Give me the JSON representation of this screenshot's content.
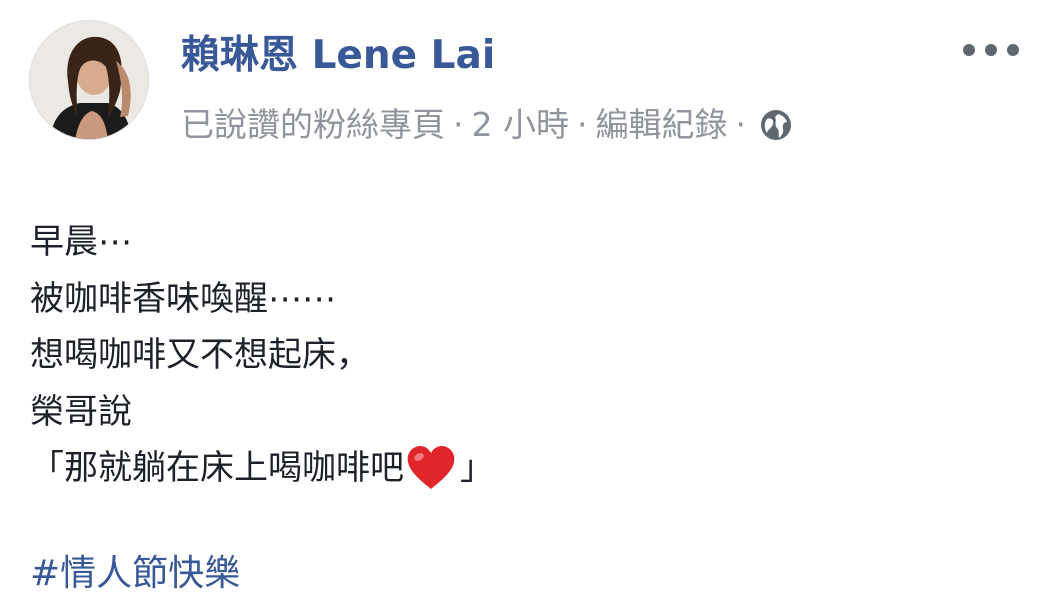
{
  "post": {
    "author_name": "賴琳恩 Lene Lai",
    "meta": {
      "liked_page": "已說讚的粉絲專頁",
      "time": "2 小時",
      "edit_history": "編輯紀錄",
      "separator": "·",
      "privacy_icon": "globe-icon"
    },
    "more_icon": "more-options-icon",
    "body_lines": [
      "早晨⋯",
      "被咖啡香味喚醒⋯⋯",
      "想喝咖啡又不想起床，",
      "榮哥說",
      "「那就躺在床上喝咖啡吧",
      "」"
    ],
    "emoji": "heart-emoji",
    "hashtag": "#情人節快樂"
  },
  "colors": {
    "author": "#385898",
    "meta": "#90949c",
    "text": "#1d2129",
    "heart": "#e0262b"
  }
}
